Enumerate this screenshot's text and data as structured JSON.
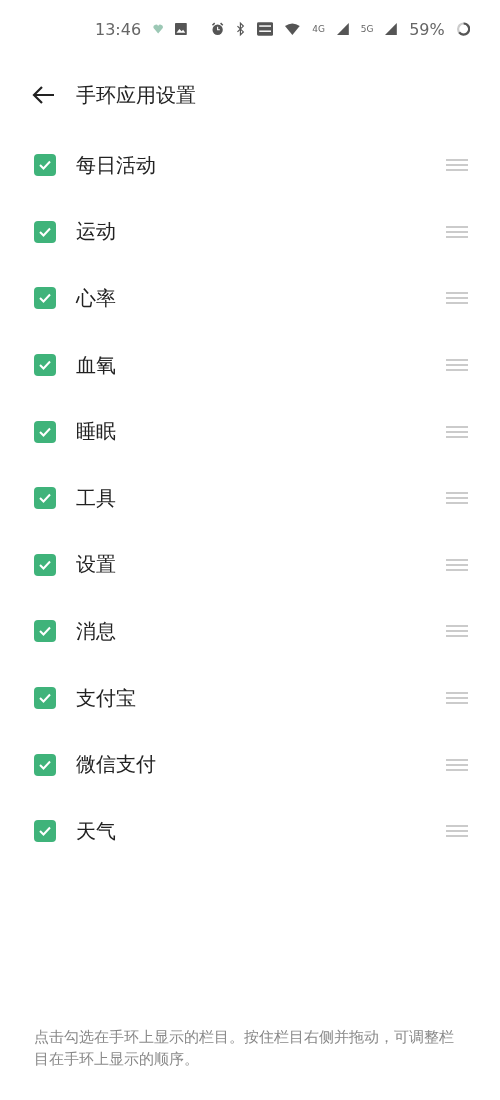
{
  "status_bar": {
    "time": "13:46",
    "signal_1": "4G",
    "signal_2": "5G",
    "battery": "59%"
  },
  "header": {
    "title": "手环应用设置"
  },
  "items": [
    {
      "label": "每日活动",
      "checked": true
    },
    {
      "label": "运动",
      "checked": true
    },
    {
      "label": "心率",
      "checked": true
    },
    {
      "label": "血氧",
      "checked": true
    },
    {
      "label": "睡眠",
      "checked": true
    },
    {
      "label": "工具",
      "checked": true
    },
    {
      "label": "设置",
      "checked": true
    },
    {
      "label": "消息",
      "checked": true
    },
    {
      "label": "支付宝",
      "checked": true
    },
    {
      "label": "微信支付",
      "checked": true
    },
    {
      "label": "天气",
      "checked": true
    }
  ],
  "footer": {
    "hint": "点击勾选在手环上显示的栏目。按住栏目右侧并拖动，可调整栏目在手环上显示的顺序。"
  }
}
